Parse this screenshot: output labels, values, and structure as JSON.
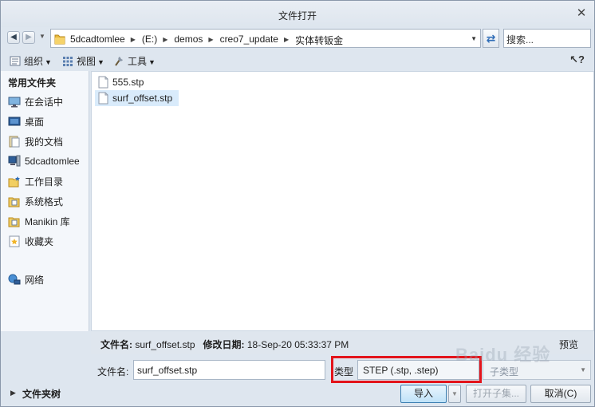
{
  "window": {
    "title": "文件打开"
  },
  "nav": {
    "breadcrumbs": [
      "5dcadtomlee",
      "(E:)",
      "demos",
      "creo7_update",
      "实体转钣金"
    ],
    "search_placeholder": "搜索..."
  },
  "toolbar": {
    "organize": "组织",
    "view": "视图",
    "tools": "工具"
  },
  "sidebar": {
    "header": "常用文件夹",
    "items": [
      {
        "label": "在会话中",
        "icon": "session-monitor-icon"
      },
      {
        "label": "桌面",
        "icon": "desktop-icon"
      },
      {
        "label": "我的文档",
        "icon": "documents-icon"
      },
      {
        "label": "5dcadtomlee",
        "icon": "computer-icon"
      },
      {
        "label": "工作目录",
        "icon": "working-dir-icon"
      },
      {
        "label": "系统格式",
        "icon": "system-format-icon"
      },
      {
        "label": "Manikin 库",
        "icon": "manikin-library-icon"
      },
      {
        "label": "收藏夹",
        "icon": "favorites-icon"
      },
      {
        "label": "网络",
        "icon": "network-icon"
      }
    ],
    "folder_tree": "文件夹树"
  },
  "files": [
    {
      "name": "555.stp",
      "selected": false
    },
    {
      "name": "surf_offset.stp",
      "selected": true
    }
  ],
  "details": {
    "name_label": "文件名:",
    "name_value": "surf_offset.stp",
    "date_label": "修改日期:",
    "date_value": "18-Sep-20 05:33:37 PM",
    "preview": "预览"
  },
  "form": {
    "filename_label": "文件名:",
    "filename_value": "surf_offset.stp",
    "type_label": "类型",
    "type_value": "STEP (.stp, .step)",
    "subtype_value": "子类型"
  },
  "buttons": {
    "import": "导入",
    "open_subset": "打开子集...",
    "cancel": "取消(C)"
  },
  "watermark": "Baidu 经验",
  "colors": {
    "highlight_red": "#e3141b",
    "selection": "#d9ebfb",
    "primary_button": "#bfe2f8"
  }
}
